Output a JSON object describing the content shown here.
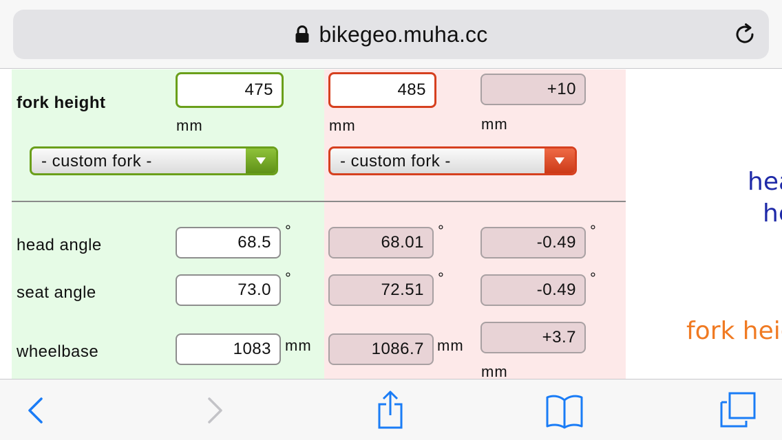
{
  "browser": {
    "url": "bikegeo.muha.cc",
    "icons": {
      "lock": "lock-icon",
      "reload": "reload-icon"
    }
  },
  "fork": {
    "label": "fork height",
    "original": "475",
    "new": "485",
    "diff": "+10",
    "unit": "mm",
    "select_original": "- custom fork -",
    "select_new": "- custom fork -"
  },
  "rows": [
    {
      "label": "head angle",
      "original": "68.5",
      "new": "68.01",
      "diff": "-0.49",
      "unit": "°"
    },
    {
      "label": "seat angle",
      "original": "73.0",
      "new": "72.51",
      "diff": "-0.49",
      "unit": "°"
    },
    {
      "label": "wheelbase",
      "original": "1083",
      "new": "1086.7",
      "diff": "+3.7",
      "unit": "mm"
    }
  ],
  "side": {
    "line1": "hea",
    "line2": "he",
    "line3": "fork heig",
    "colors": {
      "blue": "#1f2aa8",
      "orange": "#f07a22"
    }
  },
  "colors": {
    "green_border": "#6a9f1a",
    "red_border": "#d6401f",
    "green_bg": "#e6fbe6",
    "red_bg": "#fde9e9",
    "ios_blue": "#1a7cf6"
  },
  "toolbar": {
    "icons": [
      "back-icon",
      "forward-icon",
      "share-icon",
      "bookmarks-icon",
      "tabs-icon"
    ]
  }
}
